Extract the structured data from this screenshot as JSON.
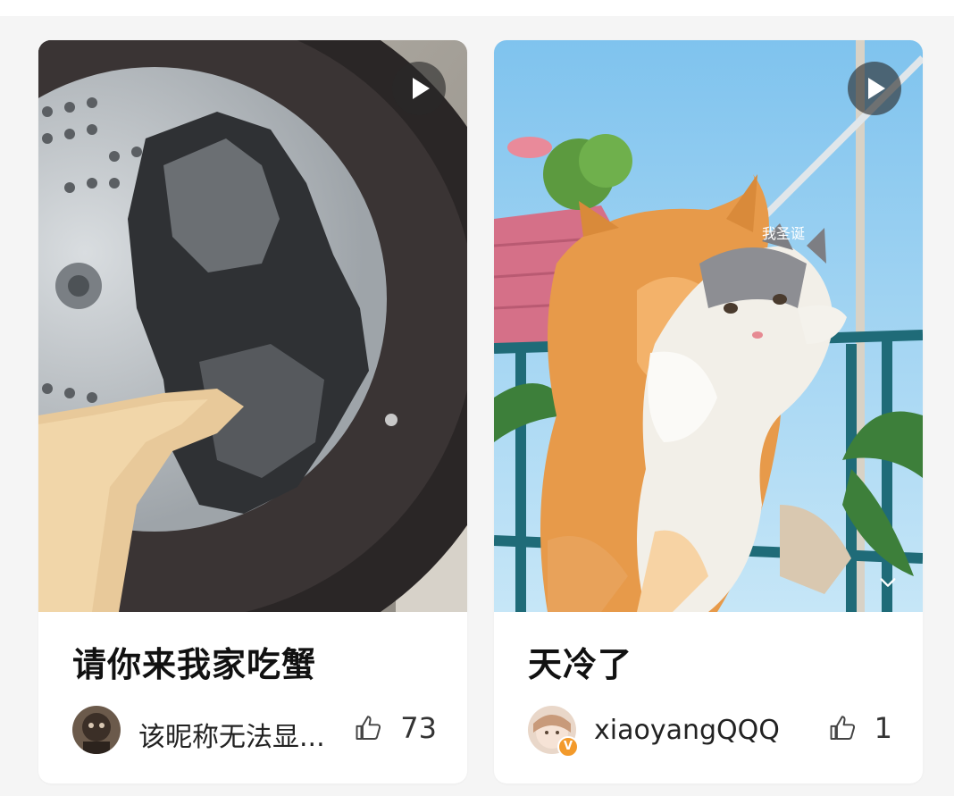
{
  "cards": [
    {
      "title": "请你来我家吃蟹",
      "author": "该昵称无法显...",
      "likes": "73",
      "media_icon": "play-icon",
      "like_icon": "thumb-up-icon"
    },
    {
      "title": "天冷了",
      "author": "xiaoyangQQQ",
      "likes": "1",
      "media_icon": "play-icon",
      "like_icon": "thumb-up-icon",
      "verified_badge": "V"
    }
  ],
  "colors": {
    "card_bg": "#ffffff",
    "page_bg": "#f5f5f5",
    "badge": "#f39a2b"
  }
}
